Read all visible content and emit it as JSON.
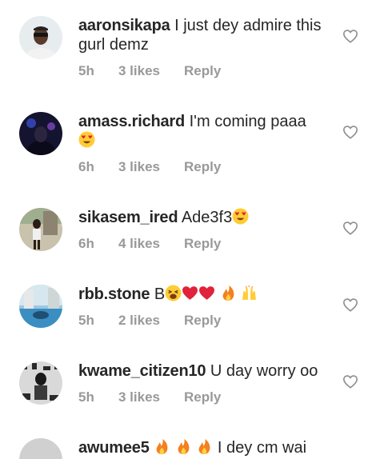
{
  "comments": [
    {
      "username": "aaronsikapa",
      "text": "I just dey admire this gurl demz",
      "time": "5h",
      "likes": "3 likes",
      "reply": "Reply",
      "avatar_color": "#dfe6ea",
      "emojis": []
    },
    {
      "username": "amass.richard",
      "text": "I'm coming paaa",
      "time": "6h",
      "likes": "3 likes",
      "reply": "Reply",
      "avatar_color": "#1b1b3a",
      "emojis": [
        "heart-eyes-emoji"
      ]
    },
    {
      "username": "sikasem_ired",
      "text": "Ade3f3",
      "time": "6h",
      "likes": "4 likes",
      "reply": "Reply",
      "avatar_color": "#b9b09a",
      "emojis": [
        "heart-eyes-emoji"
      ]
    },
    {
      "username": "rbb.stone",
      "text": "B",
      "time": "5h",
      "likes": "2 likes",
      "reply": "Reply",
      "avatar_color": "#6fa7c9",
      "emojis": [
        "weary-face-emoji",
        "red-heart-emoji",
        "red-heart-emoji",
        "fire-emoji",
        "raised-hands-emoji"
      ]
    },
    {
      "username": "kwame_citizen10",
      "text": "U day worry oo",
      "time": "5h",
      "likes": "3 likes",
      "reply": "Reply",
      "avatar_color": "#2f2f2f",
      "emojis": []
    },
    {
      "username": "awumee5",
      "text": "I dey cm wai",
      "avatar_color": "#cfcfcf",
      "emojis": [
        "fire-emoji",
        "fire-emoji",
        "fire-emoji"
      ]
    }
  ],
  "colors": {
    "text": "#262626",
    "meta": "#999999",
    "heart_stroke": "#8e8e8e"
  },
  "icons": {
    "like": "heart-outline-icon"
  }
}
